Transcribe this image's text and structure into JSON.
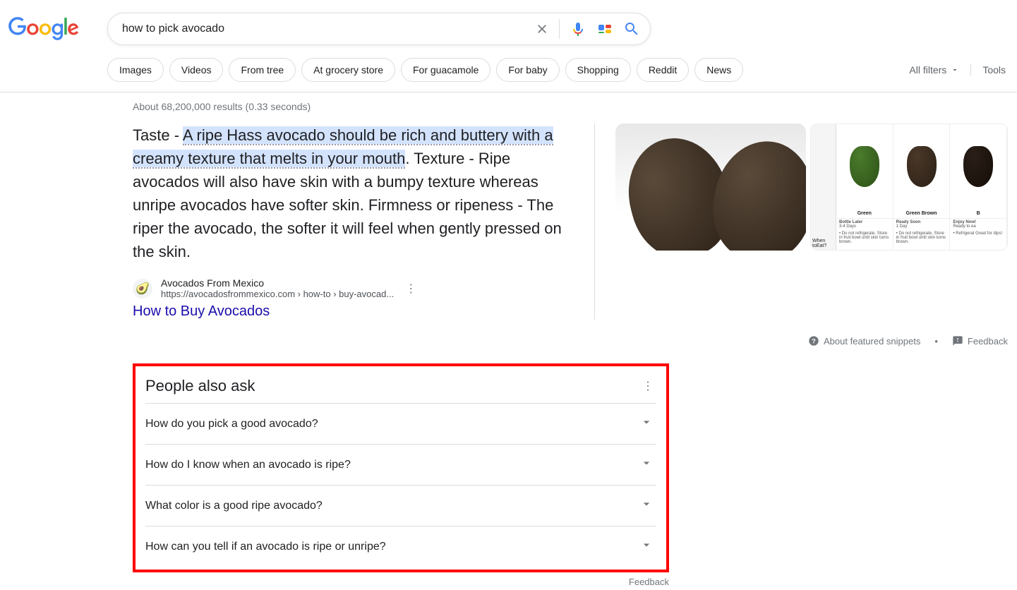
{
  "search": {
    "query": "how to pick avocado"
  },
  "chips": [
    "Images",
    "Videos",
    "From tree",
    "At grocery store",
    "For guacamole",
    "For baby",
    "Shopping",
    "Reddit",
    "News"
  ],
  "filters": {
    "all_filters": "All filters",
    "tools": "Tools"
  },
  "result_stats": "About 68,200,000 results (0.33 seconds)",
  "snippet": {
    "prefix": "Taste - ",
    "highlighted": "A ripe Hass avocado should be rich and buttery with a creamy texture that melts in your mouth",
    "suffix": ". Texture - Ripe avocados will also have skin with a bumpy texture whereas unripe avocados have softer skin. Firmness or ripeness - The riper the avocado, the softer it will feel when gently pressed on the skin."
  },
  "source": {
    "name": "Avocados From Mexico",
    "url": "https://avocadosfrommexico.com › how-to › buy-avocad...",
    "title": "How to Buy Avocados",
    "favicon": "🥑"
  },
  "chart": {
    "row1_label": "When toEat?",
    "cols": [
      {
        "name": "Green",
        "sub": "Bottle Later",
        "days": "3-4 Days",
        "note": "Do not refrigerate. Store in fruit bowl until skin turns brown."
      },
      {
        "name": "Green Brown",
        "sub": "Ready Soon",
        "days": "1 Day",
        "note": "Do not refrigerate. Store in fruit bowl until skin turns brown."
      },
      {
        "name": "B",
        "sub": "Enjoy Now!",
        "days": "Ready to ea",
        "note": "Refrigerat Great for dips!"
      }
    ]
  },
  "snippet_footer": {
    "about": "About featured snippets",
    "feedback": "Feedback"
  },
  "paa": {
    "title": "People also ask",
    "items": [
      "How do you pick a good avocado?",
      "How do I know when an avocado is ripe?",
      "What color is a good ripe avocado?",
      "How can you tell if an avocado is ripe or unripe?"
    ],
    "feedback": "Feedback"
  }
}
